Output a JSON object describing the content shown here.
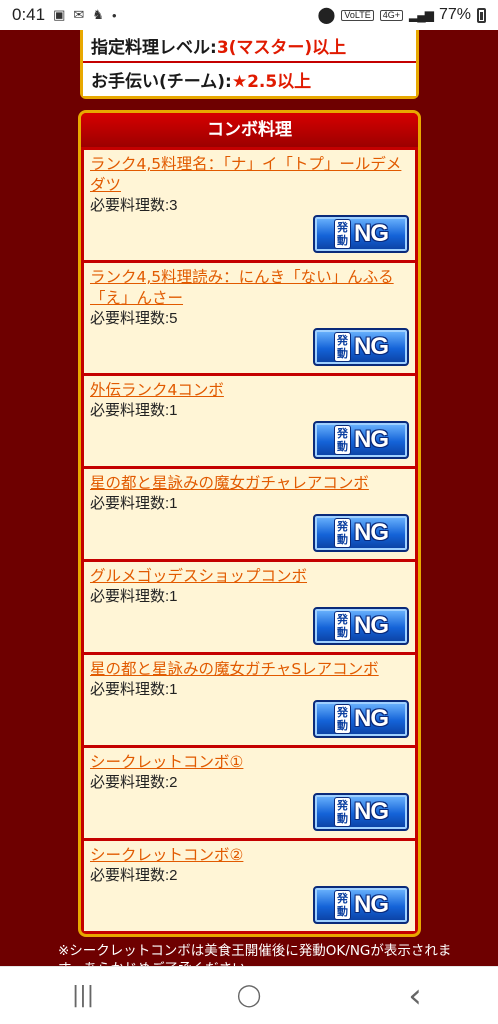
{
  "status_bar": {
    "time": "0:41",
    "icons_left": [
      "image-icon",
      "mail-icon",
      "cat-app-icon",
      "dot-icon"
    ],
    "battery": "77%",
    "net_tag": "VoLTE",
    "net_gen": "4G+"
  },
  "info": {
    "rows": [
      {
        "label": "指定料理レベル: ",
        "value": "3(マスター)以上"
      },
      {
        "label": "お手伝い(チーム): ",
        "value": "★2.5以上"
      }
    ]
  },
  "combo": {
    "title": "コンボ料理",
    "req_prefix": "必要料理数:",
    "badge": {
      "kanji_top": "発",
      "kanji_bottom": "動",
      "status": "NG"
    },
    "items": [
      {
        "name": "ランク4,5料理名：「ナ」イ「トプ」ールデメダツ",
        "required": "3"
      },
      {
        "name": "ランク4,5料理読み：にんき「ない」んふる「え」んさー",
        "required": "5"
      },
      {
        "name": "外伝ランク4コンボ",
        "required": "1"
      },
      {
        "name": "星の都と星詠みの魔女ガチャレアコンボ",
        "required": "1"
      },
      {
        "name": "グルメゴッデスショップコンボ",
        "required": "1"
      },
      {
        "name": "星の都と星詠みの魔女ガチャSレアコンボ",
        "required": "1"
      },
      {
        "name": "シークレットコンボ①",
        "required": "2"
      },
      {
        "name": "シークレットコンボ②",
        "required": "2"
      }
    ]
  },
  "footnote": "※シークレットコンボは美食王開催後に発動OK/NGが表示されます。あらかじめご了承ください。",
  "nav": {
    "recent": "|||",
    "home": "◯",
    "back": "‹"
  },
  "colors": {
    "page_bg": "#6e0000",
    "panel_red": "#c40000",
    "gold_border": "#e8a800",
    "link_orange": "#e15a00",
    "badge_blue": "#1463d8"
  }
}
